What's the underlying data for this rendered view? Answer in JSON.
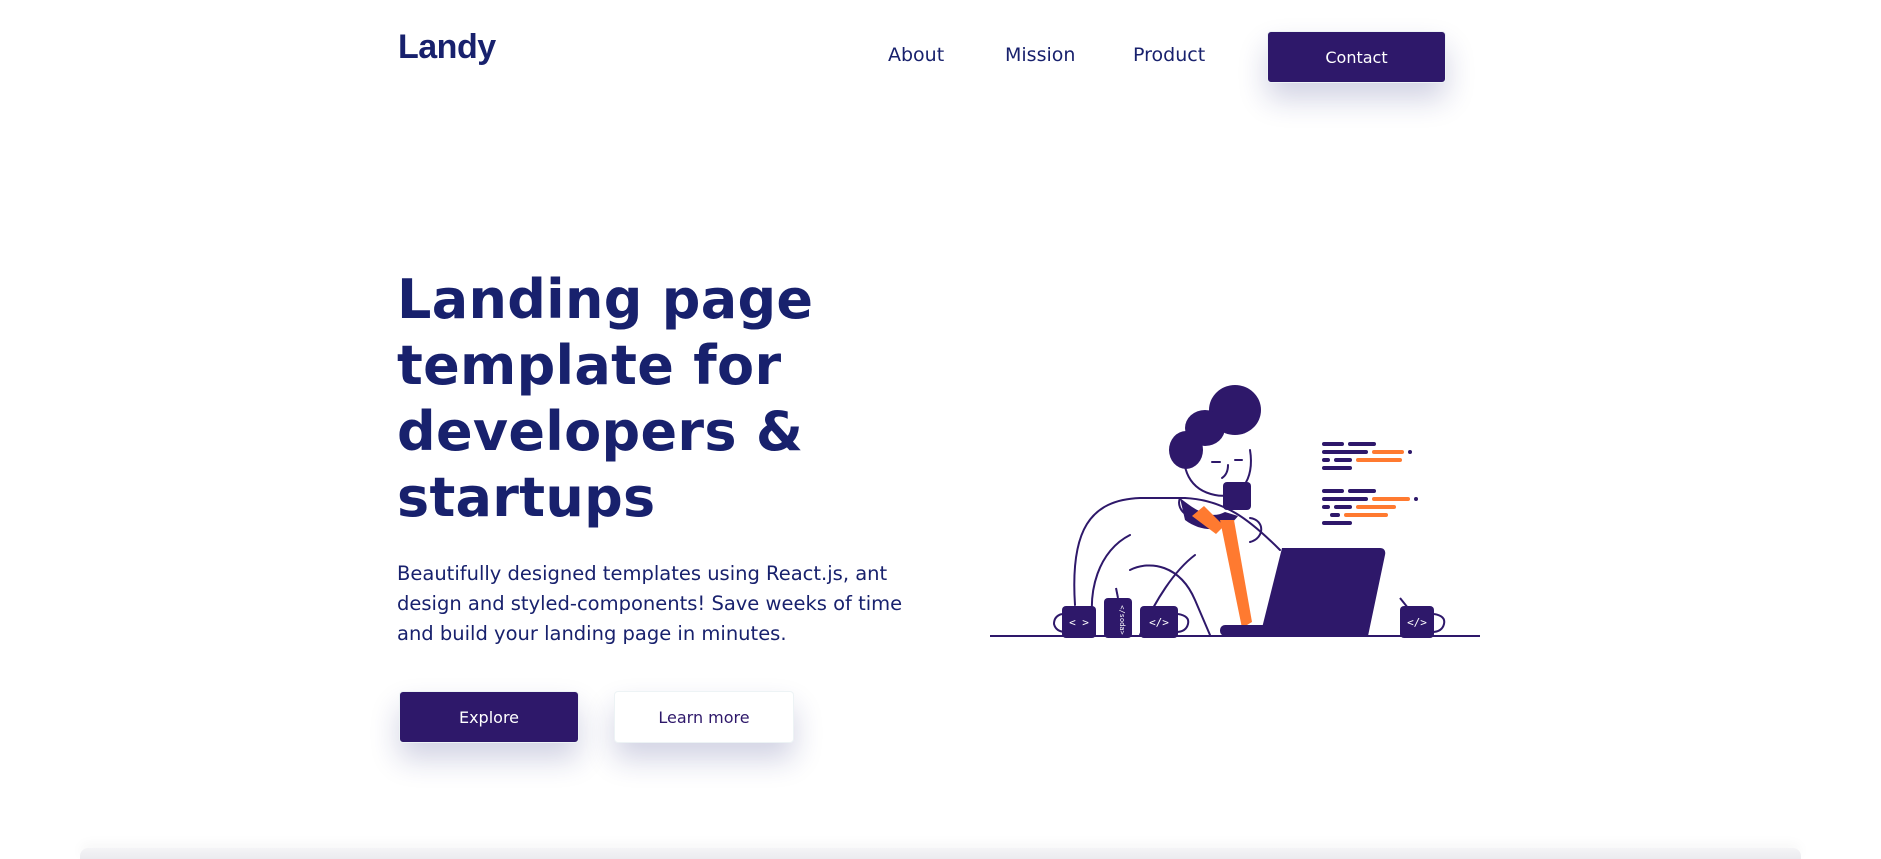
{
  "header": {
    "logo": "Landy",
    "nav": {
      "about": "About",
      "mission": "Mission",
      "product": "Product",
      "contact": "Contact"
    }
  },
  "hero": {
    "title": "Landing page template for developers & startups",
    "description": "Beautifully designed templates using React.js, ant design and styled-components! Save weeks of time and build your landing page in minutes.",
    "explore_label": "Explore",
    "learn_more_label": "Learn more",
    "illustration": {
      "mug_left_label": "< >",
      "can_label": "</soda>",
      "mug_center_label": "</>",
      "mug_right_label": "</>"
    }
  },
  "colors": {
    "primary": "#2e186a",
    "text": "#18216d",
    "accent": "#ff7a30",
    "background": "#ffffff"
  }
}
